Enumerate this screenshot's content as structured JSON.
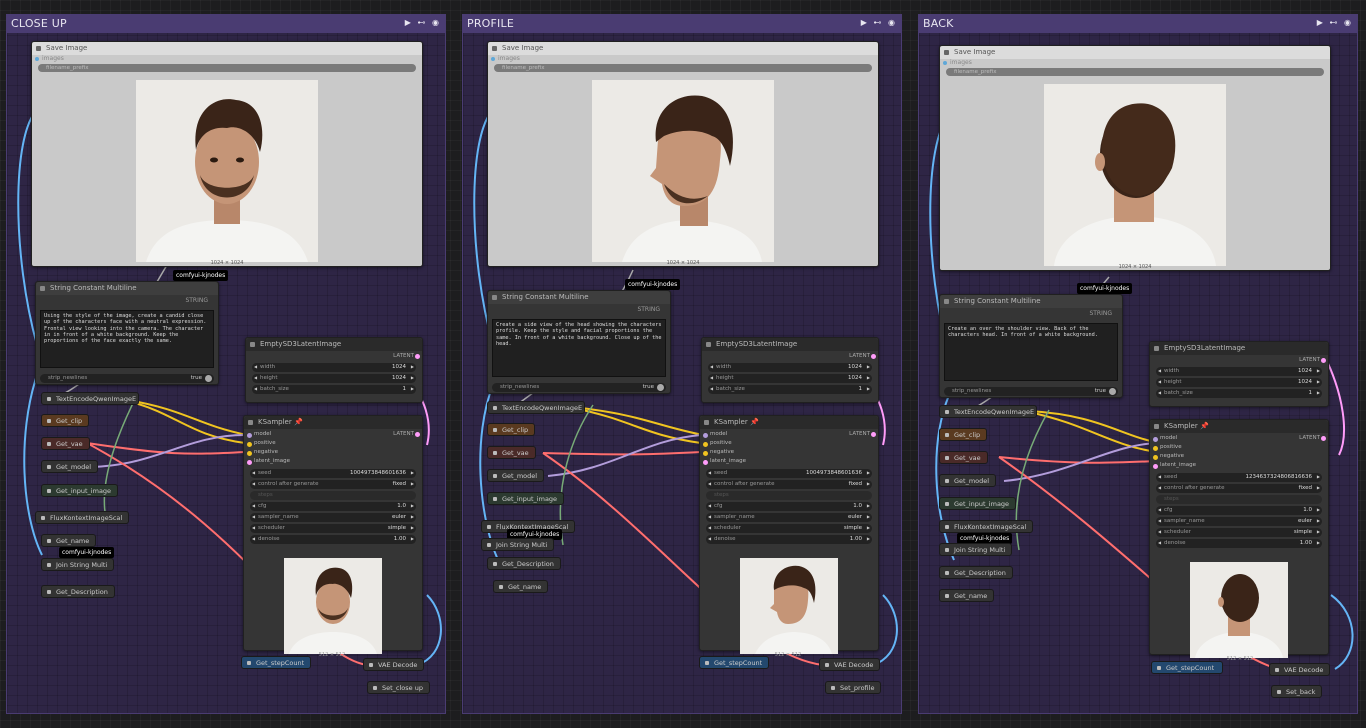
{
  "groups": [
    {
      "title": "CLOSE UP",
      "controls": "▶ ⊷ ◉",
      "save_title": "Save Image",
      "save_input": "images",
      "save_prefix": "filename_prefix",
      "save_dims": "1024 × 1024",
      "badge1": "comfyui-kjnodes",
      "str_title": "String Constant Multiline",
      "str_out": "STRING",
      "str_text": "Using the style of the image, create a candid close up of the characters face with a neutral expression. Frontal view looking into the camera. The character in in front of a white background. Keep the proportions of the face exactly the same.",
      "strip_label": "strip_newlines",
      "strip_value": "true",
      "empty_title": "EmptySD3LatentImage",
      "latent": "LATENT",
      "w_label": "width",
      "w_val": "1024",
      "h_label": "height",
      "h_val": "1024",
      "b_label": "batch_size",
      "b_val": "1",
      "ks_title": "KSampler",
      "ks_inputs": [
        "model",
        "positive",
        "negative",
        "latent_image"
      ],
      "seed_label": "seed",
      "seed_val": "1004973848601636",
      "cag_label": "control after generate",
      "cag_val": "fixed",
      "steps_label": "steps",
      "cfg_label": "cfg",
      "cfg_val": "1.0",
      "sampler_label": "sampler_name",
      "sampler_val": "euler",
      "sched_label": "scheduler",
      "sched_val": "simple",
      "denoise_label": "denoise",
      "denoise_val": "1.00",
      "preview_dims": "512 × 512",
      "te": "TextEncodeQwenImageE",
      "get_clip": "Get_clip",
      "get_vae": "Get_vae",
      "get_model": "Get_model",
      "get_input": "Get_input_image",
      "flux": "FluxKontextImageScal",
      "get_name": "Get_name",
      "badge2": "comfyui-kjnodes",
      "join": "Join String Multi",
      "get_desc": "Get_Description",
      "step": "Get_stepCount",
      "vae": "VAE Decode",
      "set": "Set_close up"
    },
    {
      "title": "PROFILE",
      "controls": "▶ ⊷ ◉",
      "save_title": "Save Image",
      "save_input": "images",
      "save_prefix": "filename_prefix",
      "save_dims": "1024 × 1024",
      "badge1": "comfyui-kjnodes",
      "str_title": "String Constant Multiline",
      "str_out": "STRING",
      "str_text": "Create a side view of the head showing the characters profile. Keep the style and facial proportions the same. In front of a white background. Close up of the head.",
      "strip_label": "strip_newlines",
      "strip_value": "true",
      "empty_title": "EmptySD3LatentImage",
      "latent": "LATENT",
      "w_label": "width",
      "w_val": "1024",
      "h_label": "height",
      "h_val": "1024",
      "b_label": "batch_size",
      "b_val": "1",
      "ks_title": "KSampler",
      "ks_inputs": [
        "model",
        "positive",
        "negative",
        "latent_image"
      ],
      "seed_label": "seed",
      "seed_val": "1004973848601636",
      "cag_label": "control after generate",
      "cag_val": "fixed",
      "steps_label": "steps",
      "cfg_label": "cfg",
      "cfg_val": "1.0",
      "sampler_label": "sampler_name",
      "sampler_val": "euler",
      "sched_label": "scheduler",
      "sched_val": "simple",
      "denoise_label": "denoise",
      "denoise_val": "1.00",
      "preview_dims": "512 × 512",
      "te": "TextEncodeQwenImageE",
      "get_clip": "Get_clip",
      "get_vae": "Get_vae",
      "get_model": "Get_model",
      "get_input": "Get_input_image",
      "flux": "FluxKontextImageScal",
      "get_name": "Get_name",
      "badge2": "comfyui-kjnodes",
      "join": "Join String Multi",
      "get_desc": "Get_Description",
      "step": "Get_stepCount",
      "vae": "VAE Decode",
      "set": "Set_profile"
    },
    {
      "title": "BACK",
      "controls": "▶ ⊷ ◉",
      "save_title": "Save Image",
      "save_input": "images",
      "save_prefix": "filename_prefix",
      "save_dims": "1024 × 1024",
      "badge1": "comfyui-kjnodes",
      "str_title": "String Constant Multiline",
      "str_out": "STRING",
      "str_text": "Create an over the shoulder view. Back of the characters head. In front of a white background.",
      "strip_label": "strip_newlines",
      "strip_value": "true",
      "empty_title": "EmptySD3LatentImage",
      "latent": "LATENT",
      "w_label": "width",
      "w_val": "1024",
      "h_label": "height",
      "h_val": "1024",
      "b_label": "batch_size",
      "b_val": "1",
      "ks_title": "KSampler",
      "ks_inputs": [
        "model",
        "positive",
        "negative",
        "latent_image"
      ],
      "seed_label": "seed",
      "seed_val": "1234637324806816636",
      "cag_label": "control after generate",
      "cag_val": "fixed",
      "steps_label": "steps",
      "cfg_label": "cfg",
      "cfg_val": "1.0",
      "sampler_label": "sampler_name",
      "sampler_val": "euler",
      "sched_label": "scheduler",
      "sched_val": "simple",
      "denoise_label": "denoise",
      "denoise_val": "1.00",
      "preview_dims": "512 × 512",
      "te": "TextEncodeQwenImageE",
      "get_clip": "Get_clip",
      "get_vae": "Get_vae",
      "get_model": "Get_model",
      "get_input": "Get_input_image",
      "flux": "FluxKontextImageScal",
      "get_name": "Get_name",
      "badge2": "comfyui-kjnodes",
      "join": "Join String Multi",
      "get_desc": "Get_Description",
      "step": "Get_stepCount",
      "vae": "VAE Decode",
      "set": "Set_back"
    }
  ],
  "colors": {
    "group_bg": "#2e2545",
    "group_header": "#4a3c72",
    "node_bg": "#353535",
    "wire_clip": "#f0c420",
    "wire_vae": "#ff6e6e",
    "wire_model": "#b39ddb",
    "wire_image": "#64b5f6",
    "wire_latent": "#ff9cf9",
    "wire_string": "#77aa77"
  }
}
